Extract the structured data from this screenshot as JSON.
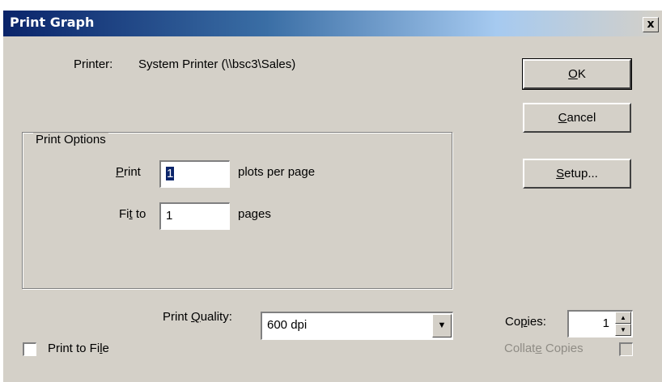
{
  "window": {
    "title": "Print Graph",
    "close_glyph": "x"
  },
  "printer": {
    "label": "Printer:",
    "value": "System Printer (\\\\bsc3\\Sales)"
  },
  "buttons": {
    "ok": {
      "mnemonic": "O",
      "rest": "K"
    },
    "cancel": {
      "mnemonic": "C",
      "rest": "ancel"
    },
    "setup": {
      "mnemonic": "S",
      "rest": "etup..."
    }
  },
  "print_options": {
    "legend": "Print Options",
    "print_label_mnemonic": "P",
    "print_label_rest": "rint",
    "plots_value": "1",
    "plots_suffix": "plots per page",
    "fit_label_pre": "Fi",
    "fit_label_mnemonic": "t",
    "fit_label_post": " to",
    "pages_value": "1",
    "pages_suffix": "pages"
  },
  "quality": {
    "label_pre": "Print ",
    "label_mnemonic": "Q",
    "label_post": "uality:",
    "selected": "600 dpi"
  },
  "copies": {
    "label_pre": "Co",
    "label_mnemonic": "p",
    "label_post": "ies:",
    "value": "1"
  },
  "collate": {
    "label_pre": "Collat",
    "label_mnemonic": "e",
    "label_post": " Copies",
    "checked": false,
    "enabled": false
  },
  "print_to_file": {
    "label_pre": "Print to Fi",
    "label_mnemonic": "l",
    "label_post": "e",
    "checked": false
  },
  "icons": {
    "combo_arrow": "dropdown-arrow-icon",
    "spin_up": "spin-up-arrow-icon",
    "spin_down": "spin-down-arrow-icon"
  }
}
